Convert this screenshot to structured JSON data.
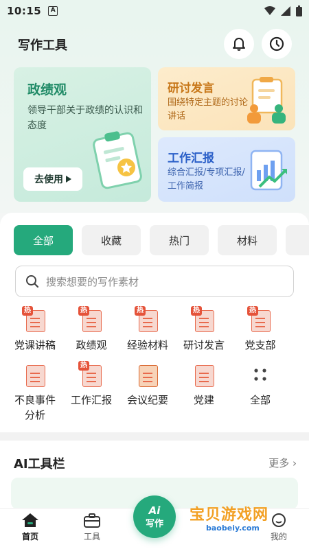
{
  "status": {
    "time": "10:15",
    "a_badge": "A"
  },
  "header": {
    "title": "写作工具"
  },
  "cards": {
    "zhengji": {
      "title": "政绩观",
      "desc": "领导干部关于政绩的认识和态度",
      "button": "去使用"
    },
    "yantao": {
      "title": "研讨发言",
      "desc": "围绕特定主题的讨论讲话"
    },
    "huibao": {
      "title": "工作汇报",
      "desc": "综合汇报/专项汇报/工作简报"
    }
  },
  "tabs": [
    "全部",
    "收藏",
    "热门",
    "材料"
  ],
  "search": {
    "placeholder": "搜索想要的写作素材"
  },
  "grid": [
    {
      "label": "党课讲稿",
      "hot": "热"
    },
    {
      "label": "政绩观",
      "hot": "热"
    },
    {
      "label": "经验材料",
      "hot": "热"
    },
    {
      "label": "研讨发言",
      "hot": "热"
    },
    {
      "label": "党支部",
      "hot": "热"
    },
    {
      "label": "不良事件分析",
      "hot": ""
    },
    {
      "label": "工作汇报",
      "hot": "热"
    },
    {
      "label": "会议纪要",
      "hot": ""
    },
    {
      "label": "党建",
      "hot": ""
    },
    {
      "label": "全部",
      "hot": ""
    }
  ],
  "ai_toolbar": {
    "title": "AI工具栏",
    "more": "更多"
  },
  "nav": {
    "home": "首页",
    "tools": "工具",
    "fab_ai": "Ai",
    "fab_write": "写作",
    "mine": "我的"
  },
  "watermark": {
    "main": "宝贝游戏网",
    "sub": "baobeiy.com"
  },
  "colors": {
    "accent": "#25a97c",
    "hot": "#e5533a"
  }
}
